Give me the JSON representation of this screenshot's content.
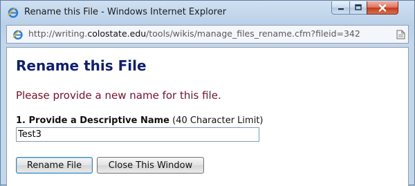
{
  "window": {
    "title": "Rename this File - Windows Internet Explorer",
    "controls": {
      "minimize_glyph": "–",
      "maximize_glyph": "□",
      "close_glyph": "✕"
    }
  },
  "addressbar": {
    "url_prefix": "http://writing.",
    "url_domain": "colostate.edu",
    "url_suffix": "/tools/wikis/manage_files_rename.cfm?fileid=342",
    "icon": "ie-page-icon"
  },
  "page": {
    "heading": "Rename this File",
    "instructions": "Please provide a new name for this file.",
    "field_label_bold": "1. Provide a Descriptive Name",
    "field_label_note": "(40 Character Limit)",
    "name_value": "Test3",
    "rename_button": "Rename File",
    "close_button": "Close This Window"
  },
  "colors": {
    "heading": "#0d1f73",
    "instructions": "#80102a",
    "close_button_bg": "#c4391b"
  }
}
